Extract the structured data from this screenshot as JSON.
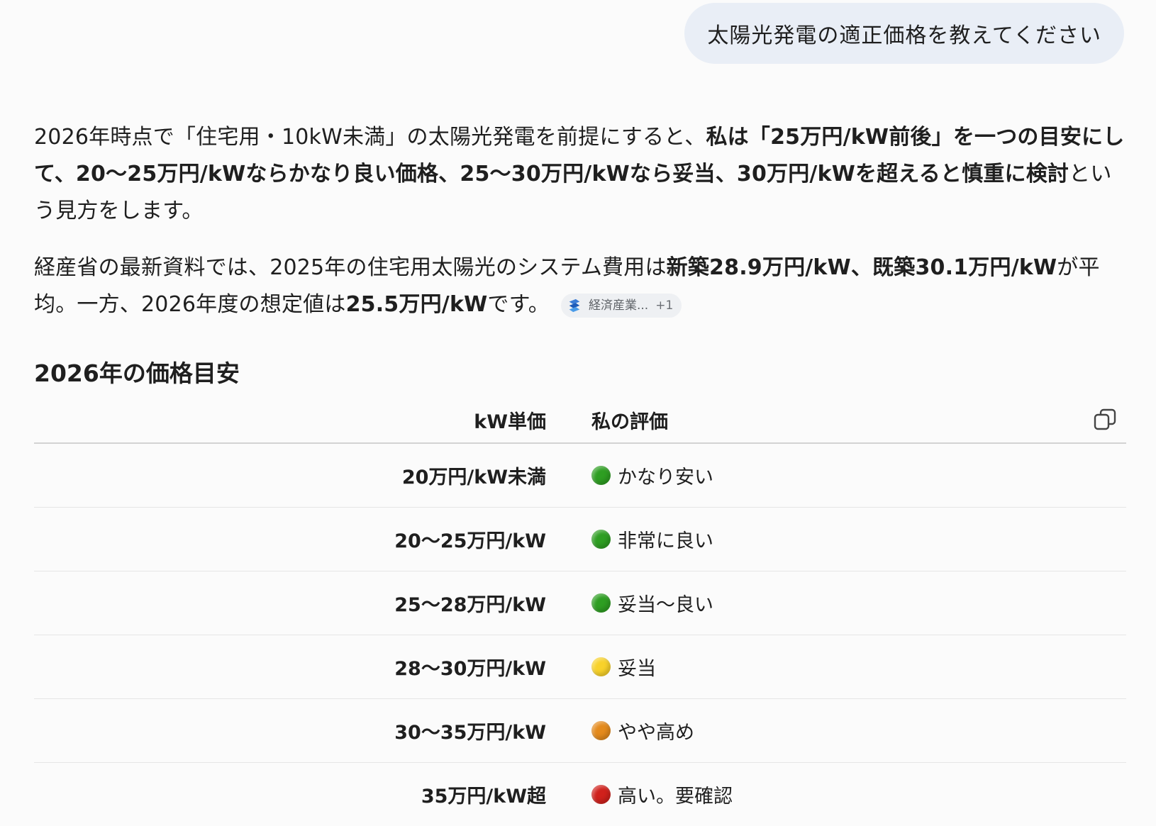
{
  "user_message": "太陽光発電の適正価格を教えてください",
  "para1": {
    "t1": "2026年時点で「住宅用・10kW未満」の太陽光発電を前提にすると、",
    "b1": "私は「25万円/kW前後」を一つの目安にして、20〜25万円/kWならかなり良い価格、25〜30万円/kWなら妥当、30万円/kWを超えると慎重に検討",
    "t2": "という見方をします。"
  },
  "para2": {
    "t1": "経産省の最新資料では、2025年の住宅用太陽光のシステム費用は",
    "b1": "新築28.9万円/kW、既築30.1万円/kW",
    "t2": "が平均。一方、2026年度の想定値は",
    "b2": "25.5万円/kW",
    "t3": "です。",
    "citation": {
      "source": "経済産業...",
      "more": "+1",
      "icon": "meti-logo-icon"
    }
  },
  "section_title": "2026年の価格目安",
  "table": {
    "headers": [
      "kW単価",
      "私の評価"
    ],
    "rows": [
      {
        "price": "20万円/kW未満",
        "eval": "かなり安い",
        "status": "green"
      },
      {
        "price": "20〜25万円/kW",
        "eval": "非常に良い",
        "status": "green"
      },
      {
        "price": "25〜28万円/kW",
        "eval": "妥当〜良い",
        "status": "green"
      },
      {
        "price": "28〜30万円/kW",
        "eval": "妥当",
        "status": "yellow"
      },
      {
        "price": "30〜35万円/kW",
        "eval": "やや高め",
        "status": "orange"
      },
      {
        "price": "35万円/kW超",
        "eval": "高い。要確認",
        "status": "red"
      }
    ]
  },
  "colors": {
    "green": "#2e9e22",
    "yellow": "#f8d22a",
    "orange": "#e48a1c",
    "red": "#d0211c",
    "bubble": "#e9eef6"
  }
}
